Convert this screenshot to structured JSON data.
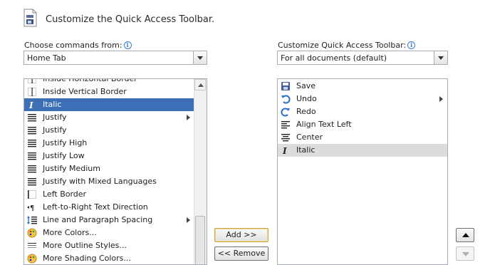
{
  "header": {
    "title": "Customize the Quick Access Toolbar."
  },
  "left": {
    "label": "Choose commands from:",
    "combo_value": "Home Tab",
    "items": [
      {
        "label": "Inside Horizontal Border",
        "icon": "inside-horizontal-border-icon"
      },
      {
        "label": "Inside Vertical Border",
        "icon": "inside-vertical-border-icon"
      },
      {
        "label": "Italic",
        "icon": "italic-icon",
        "selected": true
      },
      {
        "label": "Justify",
        "icon": "justify-icon",
        "submenu": true
      },
      {
        "label": "Justify",
        "icon": "justify-icon"
      },
      {
        "label": "Justify High",
        "icon": "justify-high-icon"
      },
      {
        "label": "Justify Low",
        "icon": "justify-low-icon"
      },
      {
        "label": "Justify Medium",
        "icon": "justify-medium-icon"
      },
      {
        "label": "Justify with Mixed Languages",
        "icon": "justify-mixed-icon"
      },
      {
        "label": "Left Border",
        "icon": "left-border-icon"
      },
      {
        "label": "Left-to-Right Text Direction",
        "icon": "ltr-direction-icon"
      },
      {
        "label": "Line and Paragraph Spacing",
        "icon": "line-spacing-icon",
        "submenu": true
      },
      {
        "label": "More Colors...",
        "icon": "palette-icon"
      },
      {
        "label": "More Outline Styles...",
        "icon": "outline-styles-icon"
      },
      {
        "label": "More Shading Colors...",
        "icon": "palette-icon"
      }
    ]
  },
  "right": {
    "label": "Customize Quick Access Toolbar:",
    "combo_value": "For all documents (default)",
    "items": [
      {
        "label": "Save",
        "icon": "save-icon"
      },
      {
        "label": "Undo",
        "icon": "undo-icon",
        "submenu": true
      },
      {
        "label": "Redo",
        "icon": "redo-icon"
      },
      {
        "label": "Align Text Left",
        "icon": "align-left-icon"
      },
      {
        "label": "Center",
        "icon": "align-center-icon"
      },
      {
        "label": "Italic",
        "icon": "italic-icon",
        "highlighted": true
      }
    ]
  },
  "buttons": {
    "add": "Add >>",
    "remove": "<< Remove"
  },
  "colors": {
    "selection": "#3d6fb6",
    "highlight": "#dcdcdc",
    "info": "#3a7bd5"
  }
}
